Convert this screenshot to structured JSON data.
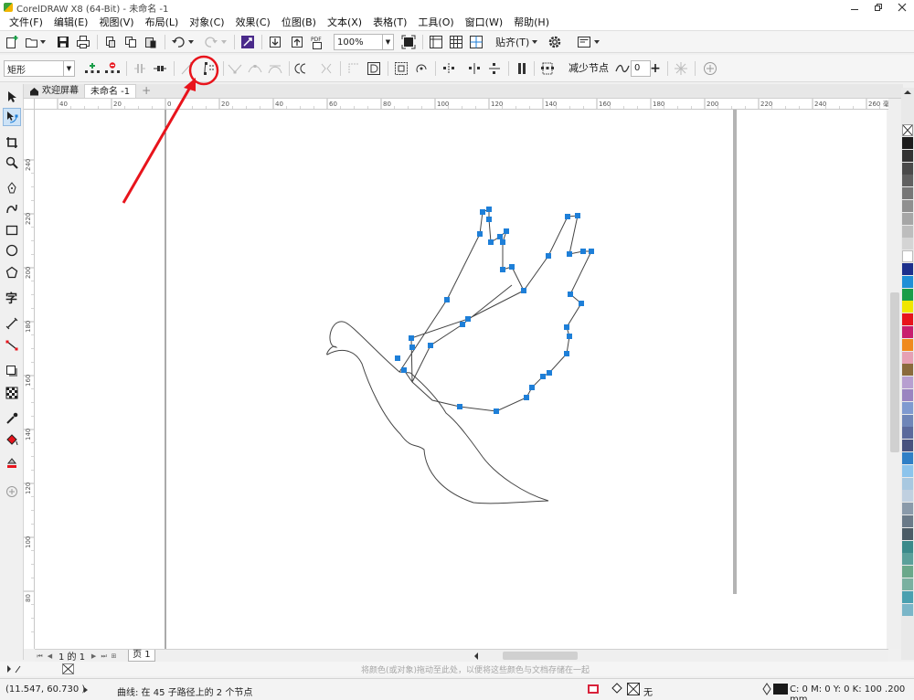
{
  "window": {
    "title": "CorelDRAW X8 (64-Bit) - 未命名 -1",
    "controls": [
      "minimize-icon",
      "restore-icon",
      "close-icon"
    ]
  },
  "menu": {
    "items": [
      "文件(F)",
      "编辑(E)",
      "视图(V)",
      "布局(L)",
      "对象(C)",
      "效果(C)",
      "位图(B)",
      "文本(X)",
      "表格(T)",
      "工具(O)",
      "窗口(W)",
      "帮助(H)"
    ]
  },
  "toolbar": {
    "zoom_value": "100%",
    "snap_label": "贴齐(T)",
    "pdf_label": "PDF"
  },
  "property_bar": {
    "shape_select": "矩形",
    "reduce_nodes_label": "减少节点",
    "smoothness_value": "0",
    "plus_label": "+"
  },
  "tabs": {
    "welcome": "欢迎屏幕",
    "document": "未命名 -1"
  },
  "rulers": {
    "h_labels": [
      "40",
      "20",
      "0",
      "20",
      "40",
      "60",
      "80",
      "100",
      "120",
      "140",
      "160",
      "180",
      "200",
      "220",
      "240",
      "260"
    ],
    "h_unit": "毫米",
    "v_labels": [
      "240",
      "220",
      "200",
      "180",
      "160",
      "140",
      "120",
      "100",
      "80"
    ]
  },
  "pages": {
    "count": "1 的 1",
    "page_tab": "页 1"
  },
  "hint": "将颜色(或对象)拖动至此处，以便将这些颜色与文档存储在一起",
  "status": {
    "coordinates": "(11.547, 60.730 )",
    "info": "曲线: 在 45 子路径上的 2 个节点",
    "fill": "无",
    "outline": "C: 0 M: 0 Y: 0 K: 100  .200 mm"
  },
  "palette_colors": [
    "#1c1c1c",
    "#333333",
    "#4a4a4a",
    "#606060",
    "#777777",
    "#8f8f8f",
    "#a6a6a6",
    "#bdbdbd",
    "#d4d4d4",
    "#ffffff",
    "#1c2f8c",
    "#1e8fd6",
    "#1a9d49",
    "#f0e600",
    "#e8141c",
    "#c81e6e",
    "#f08a1e",
    "#e6a0b4",
    "#8a6a3c",
    "#b79fd0",
    "#9a84c0",
    "#7f9ad0",
    "#6f86b8",
    "#5b6a9c",
    "#48527e",
    "#2f7fc6",
    "#8cc4ec",
    "#a8c8e0",
    "#c0d0e0",
    "#8a9aaa",
    "#6a7a88",
    "#4c5c66",
    "#3a8a8a",
    "#5aa09a",
    "#6aa88a",
    "#7ab0a0",
    "#4aa0b0",
    "#7ab6c8"
  ],
  "accent_colors": {
    "node": "#1e7fd8",
    "annotation": "#e8141c"
  }
}
